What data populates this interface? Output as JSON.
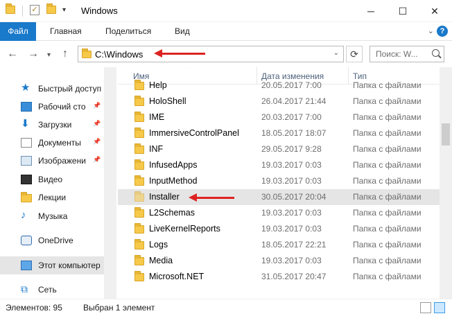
{
  "window": {
    "title": "Windows",
    "controls": {
      "minimize": "─",
      "maximize": "☐",
      "close": "✕"
    }
  },
  "ribbon": {
    "tabs": [
      "Файл",
      "Главная",
      "Поделиться",
      "Вид"
    ],
    "help_label": "?"
  },
  "nav": {
    "address": "C:\\Windows",
    "search_placeholder": "Поиск: W...",
    "back_icon": "←",
    "forward_icon": "→",
    "up_icon": "↑",
    "refresh_icon": "⟳"
  },
  "sidebar": {
    "items": [
      {
        "label": "Быстрый доступ",
        "icon": "star-icon",
        "pinned": false
      },
      {
        "label": "Рабочий сто",
        "icon": "desktop-icon",
        "pinned": true
      },
      {
        "label": "Загрузки",
        "icon": "download-icon",
        "pinned": true
      },
      {
        "label": "Документы",
        "icon": "documents-icon",
        "pinned": true
      },
      {
        "label": "Изображени",
        "icon": "pictures-icon",
        "pinned": true
      },
      {
        "label": "Видео",
        "icon": "video-icon",
        "pinned": false
      },
      {
        "label": "Лекции",
        "icon": "folder-icon",
        "pinned": false
      },
      {
        "label": "Музыка",
        "icon": "music-icon",
        "pinned": false
      },
      {
        "label": "OneDrive",
        "icon": "onedrive-icon",
        "pinned": false
      },
      {
        "label": "Этот компьютер",
        "icon": "computer-icon",
        "pinned": false
      },
      {
        "label": "Сеть",
        "icon": "network-icon",
        "pinned": false
      }
    ]
  },
  "columns": [
    "Имя",
    "Дата изменения",
    "Тип"
  ],
  "rows": [
    {
      "name": "Help",
      "date": "20.05.2017 7:00",
      "type": "Папка с файлами"
    },
    {
      "name": "HoloShell",
      "date": "26.04.2017 21:44",
      "type": "Папка с файлами"
    },
    {
      "name": "IME",
      "date": "20.03.2017 7:00",
      "type": "Папка с файлами"
    },
    {
      "name": "ImmersiveControlPanel",
      "date": "18.05.2017 18:07",
      "type": "Папка с файлами"
    },
    {
      "name": "INF",
      "date": "29.05.2017 9:28",
      "type": "Папка с файлами"
    },
    {
      "name": "InfusedApps",
      "date": "19.03.2017 0:03",
      "type": "Папка с файлами"
    },
    {
      "name": "InputMethod",
      "date": "19.03.2017 0:03",
      "type": "Папка с файлами"
    },
    {
      "name": "Installer",
      "date": "30.05.2017 20:04",
      "type": "Папка с файлами"
    },
    {
      "name": "L2Schemas",
      "date": "19.03.2017 0:03",
      "type": "Папка с файлами"
    },
    {
      "name": "LiveKernelReports",
      "date": "19.03.2017 0:03",
      "type": "Папка с файлами"
    },
    {
      "name": "Logs",
      "date": "18.05.2017 22:21",
      "type": "Папка с файлами"
    },
    {
      "name": "Media",
      "date": "19.03.2017 0:03",
      "type": "Папка с файлами"
    },
    {
      "name": "Microsoft.NET",
      "date": "31.05.2017 20:47",
      "type": "Папка с файлами"
    }
  ],
  "status": {
    "count": "Элементов: 95",
    "selected": "Выбран 1 элемент"
  },
  "colors": {
    "accent": "#1979ca",
    "folder": "#f6c94a",
    "annotation": "#dd2222",
    "selection": "#e5e5e5"
  }
}
